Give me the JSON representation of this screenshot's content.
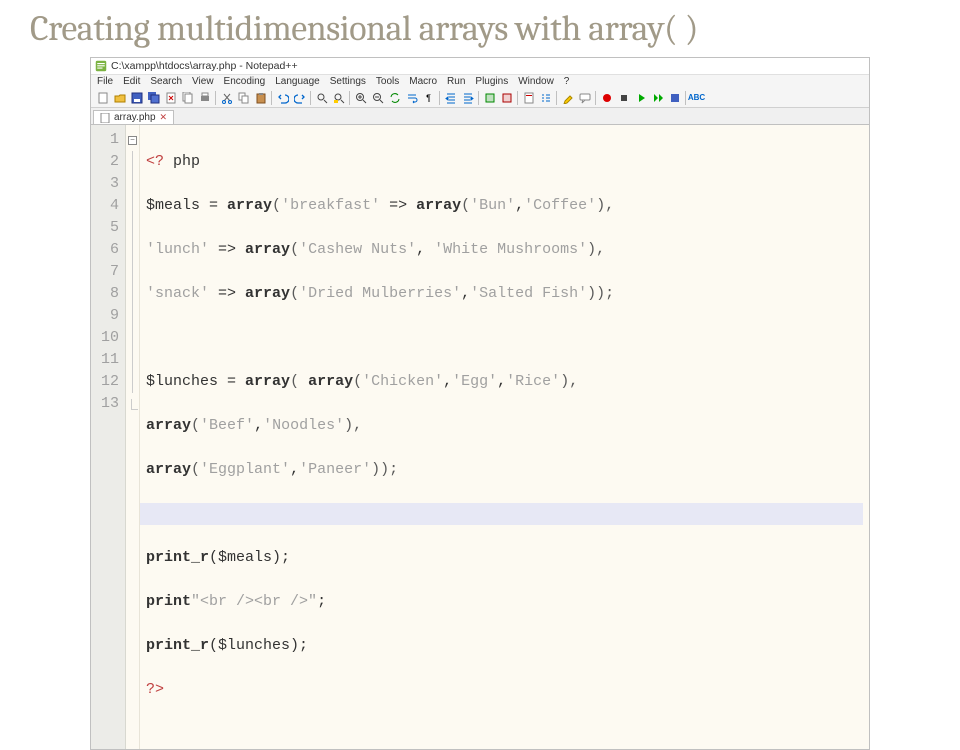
{
  "slide": {
    "title": "Creating multidimensional arrays with array( )"
  },
  "window": {
    "title": "C:\\xampp\\htdocs\\array.php - Notepad++"
  },
  "menus": [
    "File",
    "Edit",
    "Search",
    "View",
    "Encoding",
    "Language",
    "Settings",
    "Tools",
    "Macro",
    "Run",
    "Plugins",
    "Window",
    "?"
  ],
  "tab": {
    "name": "array.php",
    "close": "✕"
  },
  "toolbar_icons": [
    "new",
    "open",
    "save",
    "save-all",
    "close",
    "close-all",
    "print",
    "|",
    "cut",
    "copy",
    "paste",
    "|",
    "undo",
    "redo",
    "|",
    "find",
    "replace",
    "|",
    "zoom-in",
    "zoom-out",
    "sync",
    "word-wrap",
    "show-all",
    "|",
    "indent",
    "outdent",
    "|",
    "fold",
    "unfold",
    "|",
    "doc-map",
    "func-list",
    "|",
    "hilite",
    "comment",
    "|",
    "rec",
    "play",
    "stop",
    "playback",
    "gear",
    "|",
    "spell"
  ],
  "gutter": [
    "1",
    "2",
    "3",
    "4",
    "5",
    "6",
    "7",
    "8",
    "9",
    "10",
    "11",
    "12",
    "13"
  ],
  "code": {
    "l1_open": "<?",
    "l1_php": " php",
    "l2_a": "$meals = ",
    "l2_kw1": "array",
    "l2_b": "(",
    "l2_s1": "'breakfast'",
    "l2_c": " => ",
    "l2_kw2": "array",
    "l2_d": "(",
    "l2_s2": "'Bun'",
    "l2_e": ",",
    "l2_s3": "'Coffee'",
    "l2_f": "),",
    "l3_s1": "'lunch'",
    "l3_a": " => ",
    "l3_kw": "array",
    "l3_b": "(",
    "l3_s2": "'Cashew Nuts'",
    "l3_c": ", ",
    "l3_s3": "'White Mushrooms'",
    "l3_d": "),",
    "l4_s1": "'snack'",
    "l4_a": " => ",
    "l4_kw": "array",
    "l4_b": "(",
    "l4_s2": "'Dried Mulberries'",
    "l4_c": ",",
    "l4_s3": "'Salted Fish'",
    "l4_d": "));",
    "l6_a": "$lunches = ",
    "l6_kw1": "array",
    "l6_b": "( ",
    "l6_kw2": "array",
    "l6_c": "(",
    "l6_s1": "'Chicken'",
    "l6_d": ",",
    "l6_s2": "'Egg'",
    "l6_e": ",",
    "l6_s3": "'Rice'",
    "l6_f": "),",
    "l7_kw": "array",
    "l7_a": "(",
    "l7_s1": "'Beef'",
    "l7_b": ",",
    "l7_s2": "'Noodles'",
    "l7_c": "),",
    "l8_kw": "array",
    "l8_a": "(",
    "l8_s1": "'Eggplant'",
    "l8_b": ",",
    "l8_s2": "'Paneer'",
    "l8_c": "));",
    "l10_kw": "print_r",
    "l10_a": "($meals);",
    "l11_kw": "print",
    "l11_s": "\"<br /><br />\"",
    "l11_a": ";",
    "l12_kw": "print_r",
    "l12_a": "($lunches);",
    "l13": "?>"
  }
}
